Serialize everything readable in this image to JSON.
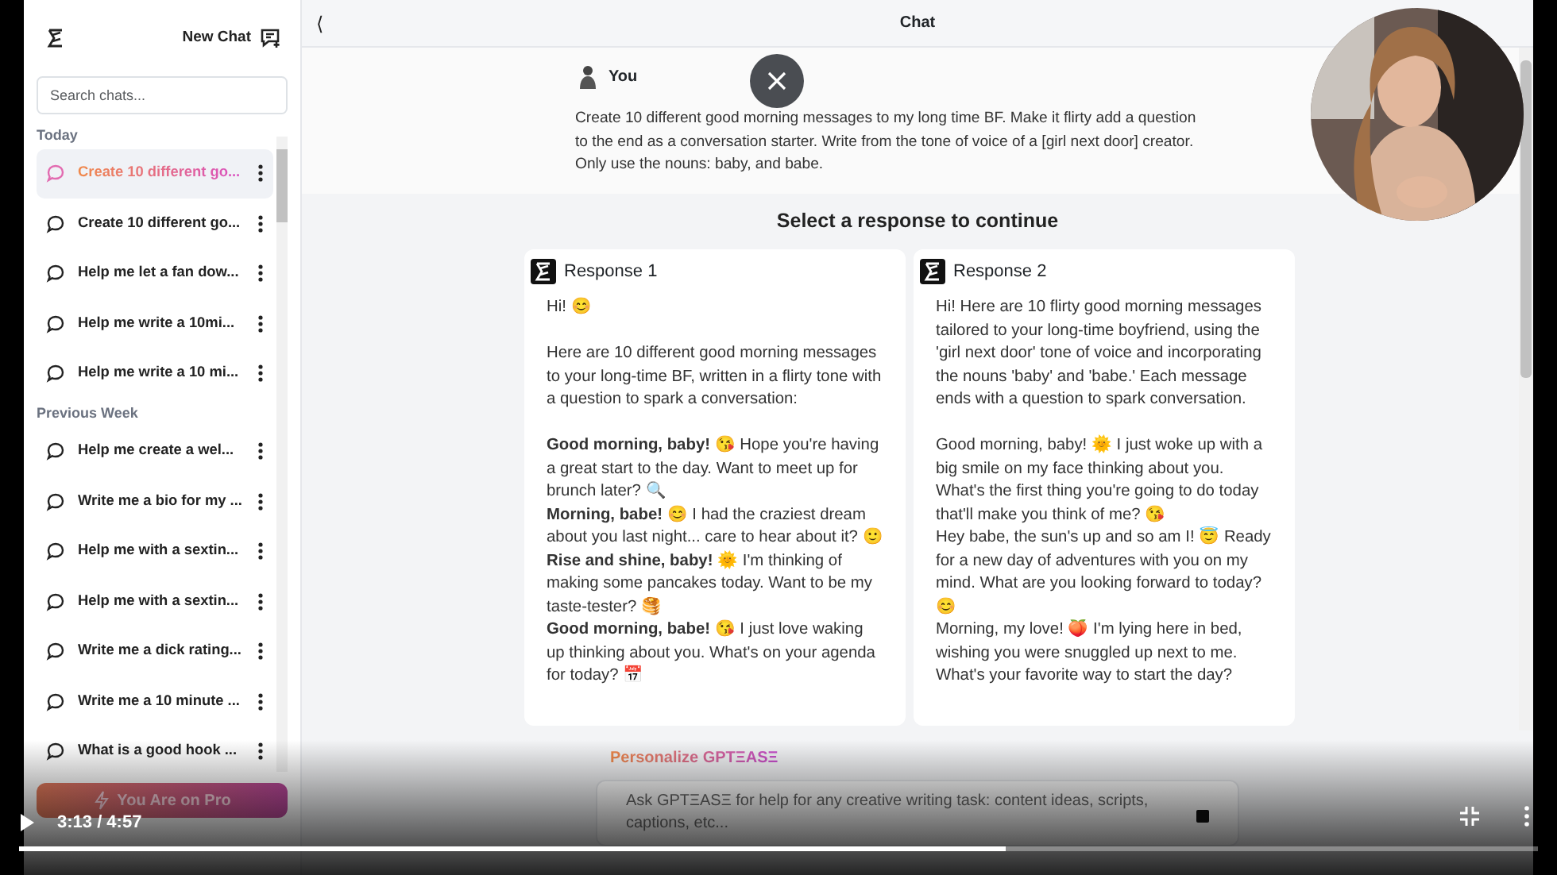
{
  "sidebar": {
    "new_chat": "New Chat",
    "search": {
      "placeholder": "Search chats..."
    },
    "groups": [
      {
        "label": "Today",
        "items": [
          {
            "title": "Create 10 different go...",
            "selected": true
          },
          {
            "title": "Create 10 different go...",
            "selected": false
          },
          {
            "title": "Help me let a fan dow...",
            "selected": false
          },
          {
            "title": "Help me write a 10mi...",
            "selected": false
          },
          {
            "title": "Help me write a 10 mi...",
            "selected": false
          }
        ]
      },
      {
        "label": "Previous Week",
        "items": [
          {
            "title": "Help me create a wel...",
            "selected": false
          },
          {
            "title": "Write me a bio for my ...",
            "selected": false
          },
          {
            "title": "Help me with a sextin...",
            "selected": false
          },
          {
            "title": "Help me with a sextin...",
            "selected": false
          },
          {
            "title": "Write me a dick rating...",
            "selected": false
          },
          {
            "title": "Write me a 10 minute ...",
            "selected": false
          },
          {
            "title": "What is a good hook ...",
            "selected": false
          }
        ]
      }
    ],
    "pro_button": "You Are on Pro"
  },
  "header": {
    "back": "⟨",
    "title": "Chat"
  },
  "user_message": {
    "author": "You",
    "text": "Create 10 different good morning messages to my long time BF. Make it flirty add a question to the end as a conversation starter. Write from the tone of voice of a [girl next door] creator. Only use the nouns: baby, and babe."
  },
  "select_prompt": "Select a response to continue",
  "responses": [
    {
      "title": "Response 1",
      "paragraphs": [
        [
          "Hi! 😊"
        ],
        [
          "Here are 10 different good morning messages to your long-time BF, written in a flirty tone with a question to spark a conversation:"
        ],
        [
          "**Good morning, baby!** 😘 Hope you're having a great start to the day. Want to meet up for brunch later? 🔍",
          "**Morning, babe!** 😊 I had the craziest dream about you last night... care to hear about it? 🙂",
          "**Rise and shine, baby!** 🌞 I'm thinking of making some pancakes today. Want to be my taste-tester? 🥞",
          "**Good morning, babe!** 😘 I just love waking up thinking about you. What's on your agenda for today? 📅"
        ]
      ]
    },
    {
      "title": "Response 2",
      "paragraphs": [
        [
          "Hi! Here are 10 flirty good morning messages tailored to your long-time boyfriend, using the 'girl next door' tone of voice and incorporating the nouns 'baby' and 'babe.' Each message ends with a question to spark conversation."
        ],
        [
          "Good morning, baby! 🌞 I just woke up with a big smile on my face thinking about you. What's the first thing you're going to do today that'll make you think of me? 😘",
          "Hey babe, the sun's up and so am I! 😇 Ready for a new day of adventures with you on my mind. What are you looking forward to today? 😊",
          "Morning, my love! 🍑 I'm lying here in bed, wishing you were snuggled up next to me. What's your favorite way to start the day?"
        ]
      ]
    }
  ],
  "personalize": "Personalize GPTΞASΞ",
  "composer": {
    "placeholder": "Ask GPTΞASΞ for help for any creative writing task: content ideas, scripts, captions, etc..."
  },
  "player": {
    "time": "3:13 / 4:57",
    "level": 0.65
  }
}
